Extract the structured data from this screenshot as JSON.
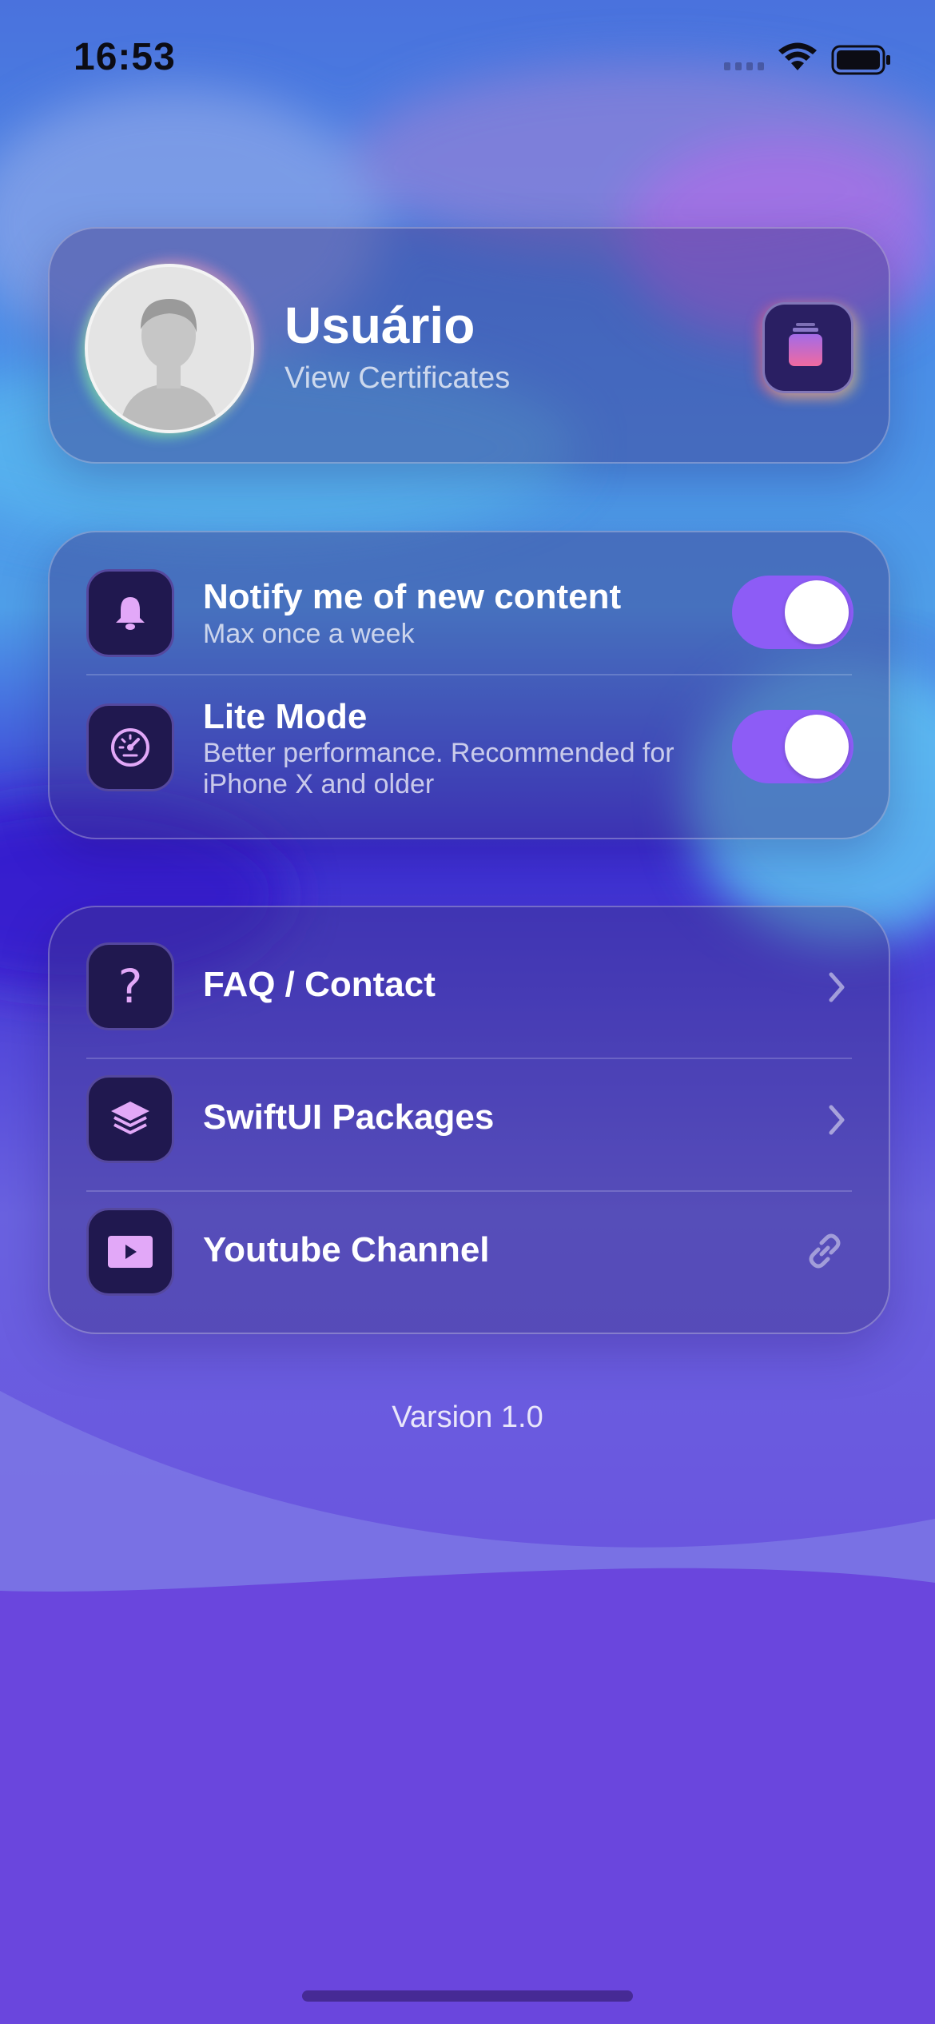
{
  "status_bar": {
    "time": "16:53"
  },
  "profile": {
    "name": "Usuário",
    "subtitle": "View Certificates"
  },
  "settings": [
    {
      "title": "Notify me of new content",
      "subtitle": "Max once a week",
      "icon": "bell-icon",
      "toggle_on": true
    },
    {
      "title": "Lite Mode",
      "subtitle": "Better performance. Recommended for iPhone X and older",
      "icon": "speedometer-icon",
      "toggle_on": true
    }
  ],
  "links": [
    {
      "label": "FAQ / Contact",
      "icon": "question-icon",
      "accessory": "chevron-right-icon"
    },
    {
      "label": "SwiftUI Packages",
      "icon": "stack-icon",
      "accessory": "chevron-right-icon"
    },
    {
      "label": "Youtube Channel",
      "icon": "play-icon",
      "accessory": "link-icon"
    }
  ],
  "footer": {
    "version": "Varsion 1.0"
  },
  "colors": {
    "accent": "#8d5cf6",
    "icon_tint": "#e2a8f8",
    "background": "#6a47dc"
  }
}
